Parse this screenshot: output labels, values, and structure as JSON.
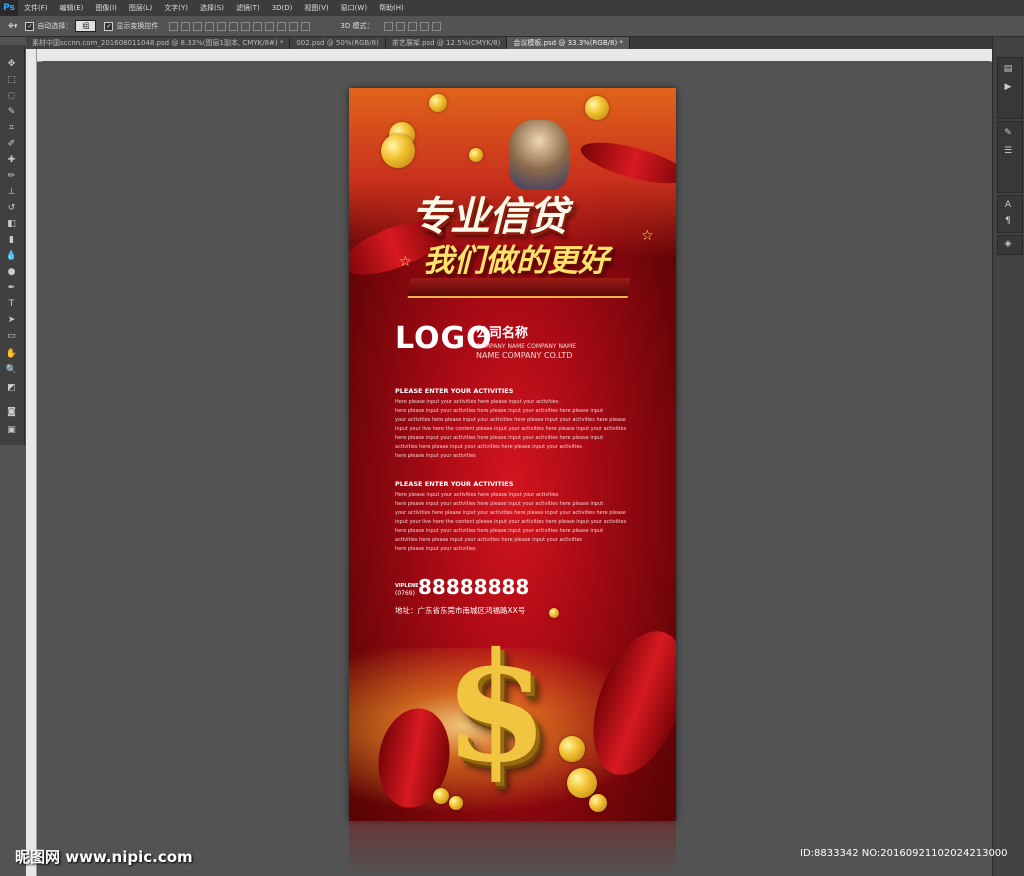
{
  "app": {
    "logo": "Ps"
  },
  "menubar": {
    "items": [
      "文件(F)",
      "编辑(E)",
      "图像(I)",
      "图层(L)",
      "文字(Y)",
      "选择(S)",
      "滤镜(T)",
      "3D(D)",
      "视图(V)",
      "窗口(W)",
      "帮助(H)"
    ]
  },
  "optionsbar": {
    "auto_select_label": "自动选择：",
    "auto_select_value": "组",
    "show_transform_label": "显示变换控件",
    "mode_3d_label": "3D 模式："
  },
  "tabs": [
    {
      "label": "素材中国sccnn.com_201608011048.psd @ 8.33%(图层1副本, CMYK/8#) *"
    },
    {
      "label": "002.psd @ 50%(RGB/8)"
    },
    {
      "label": "茶艺展架.psd @ 12.5%(CMYK/8)"
    },
    {
      "label": "会议模板.psd @ 33.3%(RGB/8) *"
    }
  ],
  "poster": {
    "headline1": "专业信贷",
    "headline2": "我们做的更好",
    "logo": "LOGO",
    "company_cn": "公司名称",
    "company_en1": "COMPANY NAME COMPANY NAME",
    "company_en2": "NAME COMPANY CO.LTD",
    "activity1": {
      "title": "PLEASE ENTER YOUR ACTIVITIES",
      "lines": [
        "Here please input your activities here please input your activities",
        "here please input your activities here please input your activities here please input",
        "your activities here please input your activities here please input your activities here please",
        "input your live here the content please input your activities here please input your activities",
        "here please input your activities here please input your activities here please input",
        " activities here please input your activities here please input your activities",
        "here please input your activities"
      ]
    },
    "activity2": {
      "title": "PLEASE ENTER YOUR ACTIVITIES",
      "lines": [
        "Here please input your activities here please input your activities",
        "here please input your activities here please input your activities here please input",
        "your activities here please input your activities here please input your activities here please",
        "input your live here the content please input your activities here please input your activities",
        "here please input your activities here please input your activities here please input",
        " activities here please input your activities here please input your activities",
        "here please input your activities"
      ]
    },
    "hotline_label": "VIPLENE",
    "hotline_area": "(0769)",
    "phone": "88888888",
    "address": "地址：广东省东莞市南城区鸿福路XX号"
  },
  "watermark": {
    "left": "昵图网 www.nipic.com",
    "right": "ID:8833342 NO:20160921102024213000"
  }
}
